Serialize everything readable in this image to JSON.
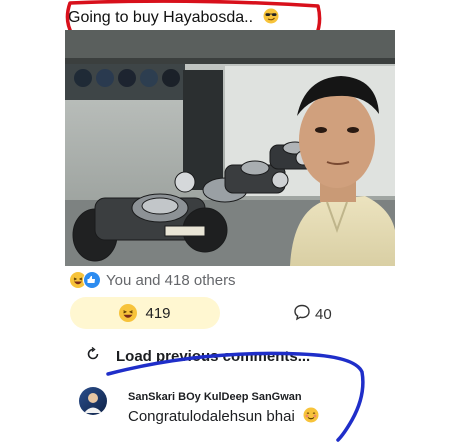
{
  "post": {
    "caption": "Going to buy Hayabosda..",
    "caption_emoji": "smirk-sunglasses-emoji"
  },
  "reactions": {
    "summary": "You and 418 others",
    "icons": [
      "haha-reaction-icon",
      "like-reaction-icon"
    ],
    "haha_count": "419",
    "comment_count": "40"
  },
  "comments": {
    "load_previous_label": "Load previous comments...",
    "items": [
      {
        "author": "SanSkari BOy KulDeep SanGwan",
        "text": "Congratulodalehsun bhai",
        "emoji": "blush-emoji"
      }
    ]
  },
  "annotations": {
    "red_circle_color": "#d8101b",
    "blue_scribble_color": "#1f2ec9"
  },
  "colors": {
    "pill_background": "#fff7d1",
    "secondary_text": "#65676b",
    "haha_yellow": "#f7c33a",
    "like_blue": "#2d8cf0"
  }
}
